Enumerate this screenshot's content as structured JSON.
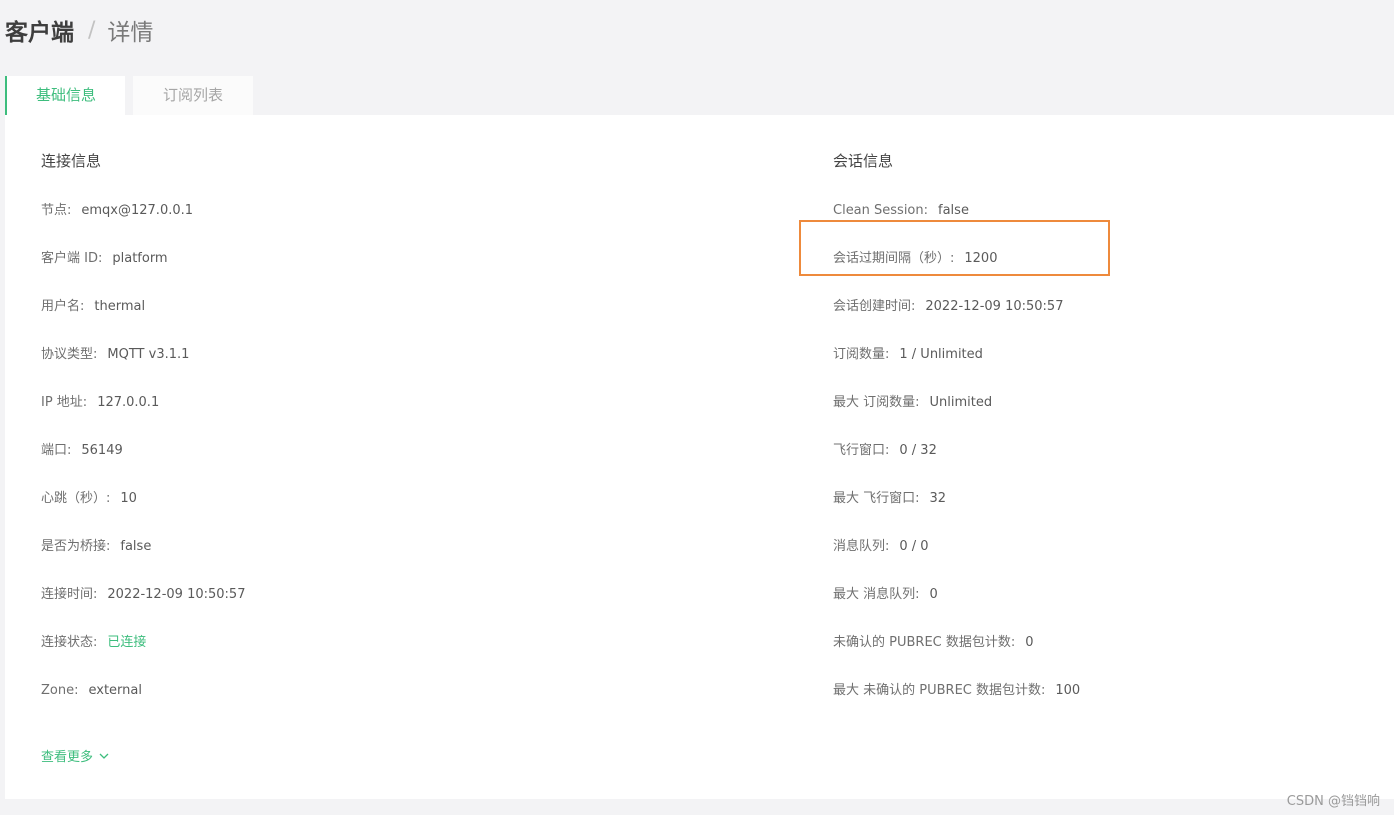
{
  "breadcrumb": {
    "root": "客户端",
    "separator": "/",
    "current": "详情"
  },
  "tabs": [
    {
      "label": "基础信息",
      "active": true
    },
    {
      "label": "订阅列表",
      "active": false
    }
  ],
  "connection": {
    "title": "连接信息",
    "fields": [
      {
        "label": "节点:",
        "value": "emqx@127.0.0.1"
      },
      {
        "label": "客户端 ID:",
        "value": "platform"
      },
      {
        "label": "用户名:",
        "value": "thermal"
      },
      {
        "label": "协议类型:",
        "value": "MQTT v3.1.1"
      },
      {
        "label": "IP 地址:",
        "value": "127.0.0.1"
      },
      {
        "label": "端口:",
        "value": "56149"
      },
      {
        "label": "心跳（秒）:",
        "value": "10"
      },
      {
        "label": "是否为桥接:",
        "value": "false"
      },
      {
        "label": "连接时间:",
        "value": "2022-12-09 10:50:57"
      },
      {
        "label": "连接状态:",
        "value": "已连接"
      },
      {
        "label": "Zone:",
        "value": "external"
      }
    ]
  },
  "session": {
    "title": "会话信息",
    "fields": [
      {
        "label": "Clean Session:",
        "value": "false"
      },
      {
        "label": "会话过期间隔（秒）:",
        "value": "1200"
      },
      {
        "label": "会话创建时间:",
        "value": "2022-12-09 10:50:57"
      },
      {
        "label": "订阅数量:",
        "value": "1 / Unlimited"
      },
      {
        "label": "最大 订阅数量:",
        "value": "Unlimited"
      },
      {
        "label": "飞行窗口:",
        "value": "0 / 32"
      },
      {
        "label": "最大 飞行窗口:",
        "value": "32"
      },
      {
        "label": "消息队列:",
        "value": "0 / 0"
      },
      {
        "label": "最大 消息队列:",
        "value": "0"
      },
      {
        "label": "未确认的 PUBREC 数据包计数:",
        "value": "0"
      },
      {
        "label": "最大 未确认的 PUBREC 数据包计数:",
        "value": "100"
      }
    ]
  },
  "more_link": {
    "label": "查看更多",
    "icon": "chevron-down-icon"
  },
  "watermark": "CSDN @铛铛响",
  "colors": {
    "accent": "#3dbd7d",
    "highlight": "#ee8a3c",
    "background": "#f3f3f5"
  }
}
